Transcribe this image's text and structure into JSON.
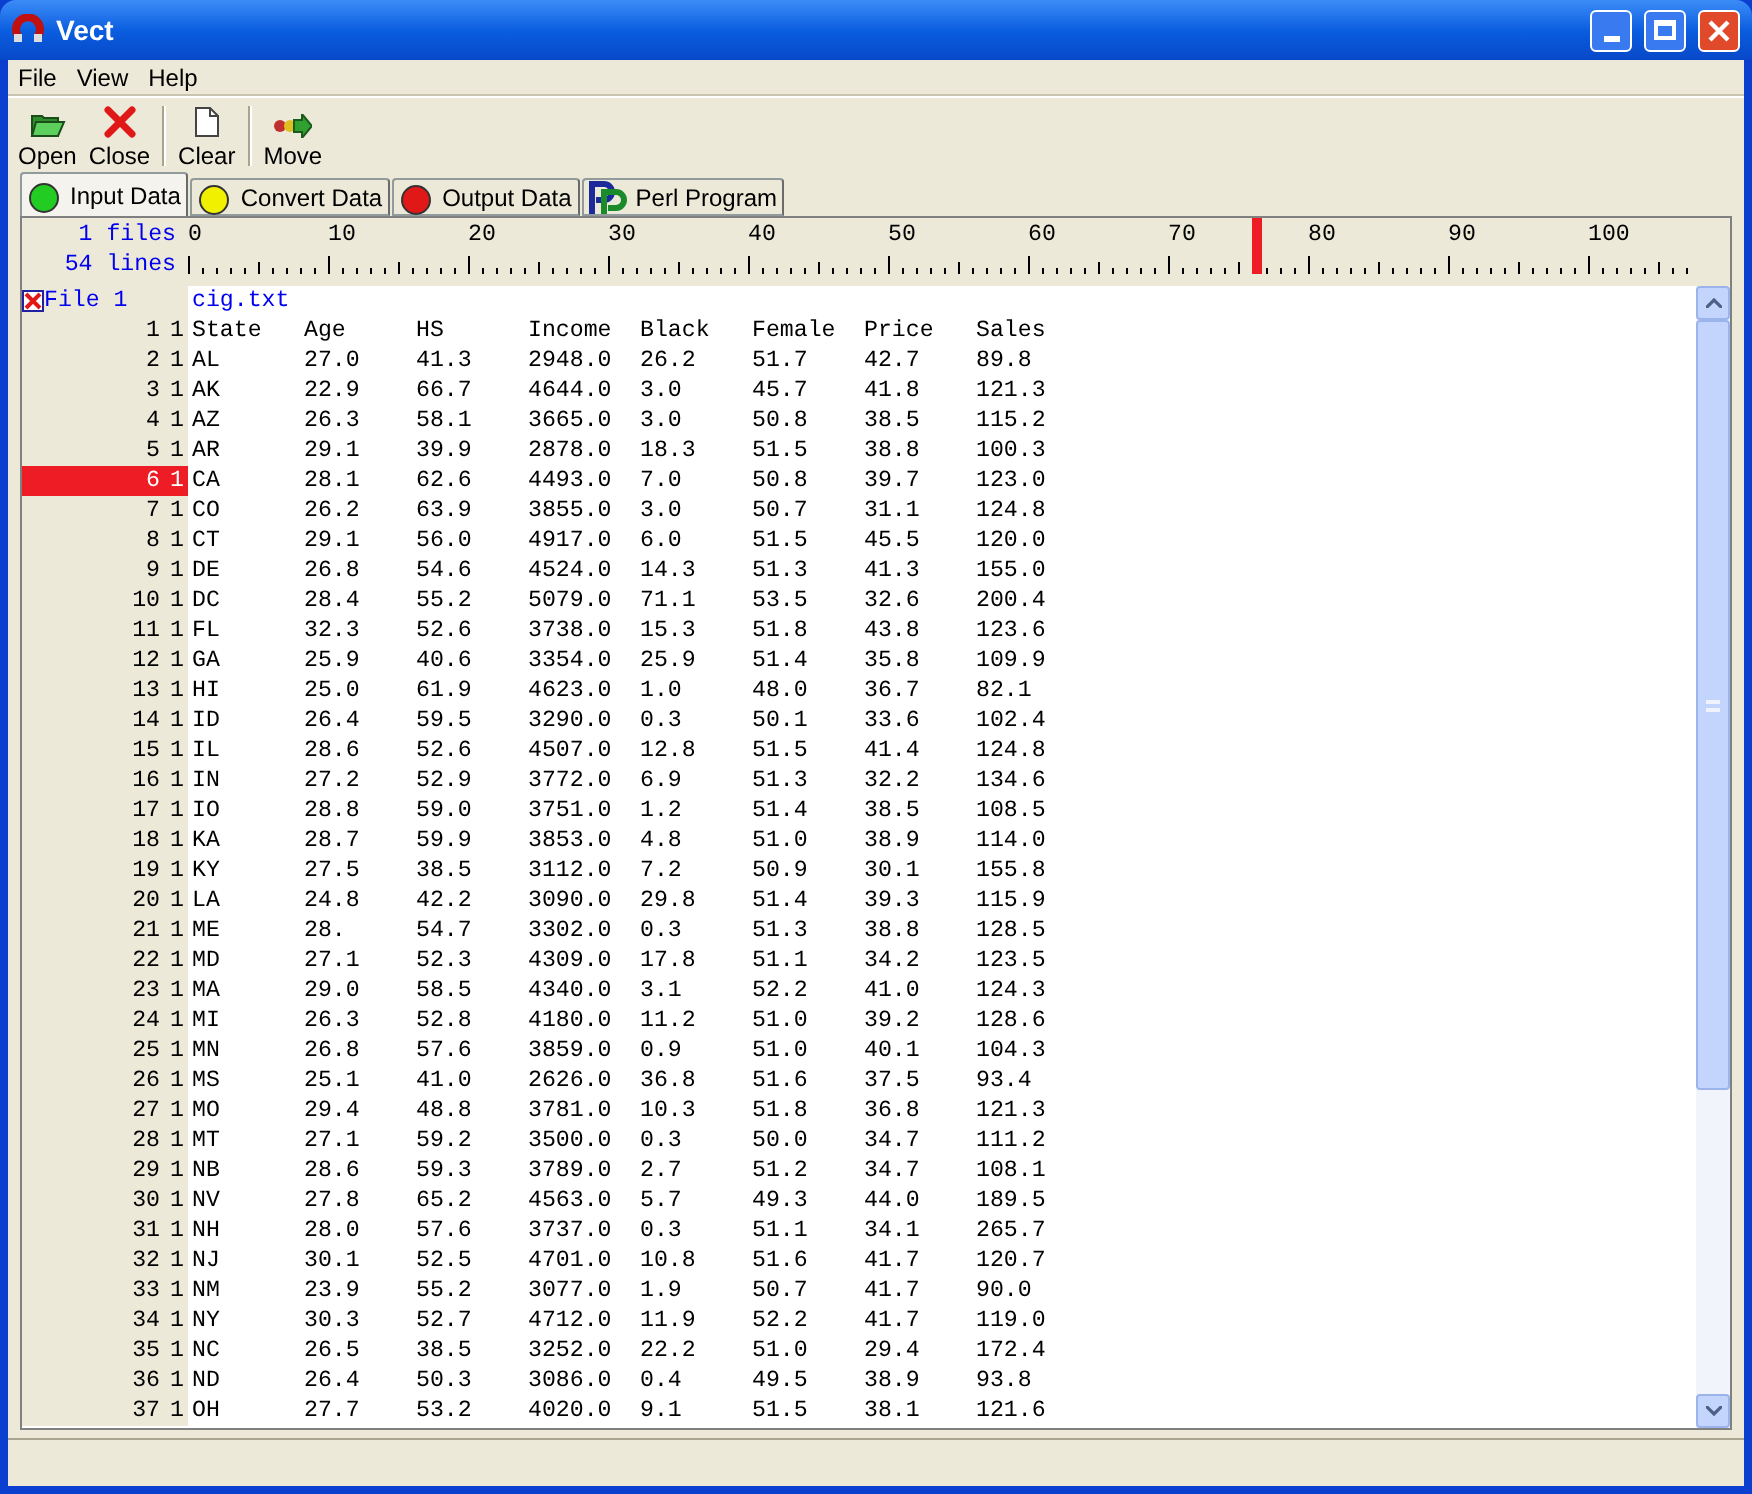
{
  "window": {
    "title": "Vect"
  },
  "menu": [
    "File",
    "View",
    "Help"
  ],
  "toolbar": [
    {
      "label": "Open",
      "kind": "open"
    },
    {
      "label": "Close",
      "kind": "close"
    },
    {
      "label": "Clear",
      "kind": "clear"
    },
    {
      "label": "Move",
      "kind": "move"
    }
  ],
  "tabs": [
    {
      "label": "Input Data",
      "kind": "light",
      "color": "#22cc22",
      "selected": true
    },
    {
      "label": "Convert Data",
      "kind": "light",
      "color": "#f0f000",
      "selected": false
    },
    {
      "label": "Output Data",
      "kind": "light",
      "color": "#e01818",
      "selected": false
    },
    {
      "label": "Perl Program",
      "kind": "perl",
      "selected": false
    }
  ],
  "info": {
    "files": "1 files",
    "lines": "54 lines"
  },
  "ruler": {
    "labels": [
      "0",
      "10",
      "20",
      "30",
      "40",
      "50",
      "60",
      "70",
      "80",
      "90",
      "100"
    ],
    "marker": {
      "level": 0.705
    }
  },
  "file": {
    "label": "File 1",
    "name": "cig.txt"
  },
  "rows": [
    {
      "n": "1",
      "f": "1",
      "selected": false,
      "cells": [
        "State",
        "Age",
        "HS",
        "Income",
        "Black",
        "Female",
        "Price",
        "Sales"
      ]
    },
    {
      "n": "2",
      "f": "1",
      "selected": false,
      "cells": [
        "AL",
        "27.0",
        "41.3",
        "2948.0",
        "26.2",
        "51.7",
        "42.7",
        "89.8"
      ]
    },
    {
      "n": "3",
      "f": "1",
      "selected": false,
      "cells": [
        "AK",
        "22.9",
        "66.7",
        "4644.0",
        "3.0",
        "45.7",
        "41.8",
        "121.3"
      ]
    },
    {
      "n": "4",
      "f": "1",
      "selected": false,
      "cells": [
        "AZ",
        "26.3",
        "58.1",
        "3665.0",
        "3.0",
        "50.8",
        "38.5",
        "115.2"
      ]
    },
    {
      "n": "5",
      "f": "1",
      "selected": false,
      "cells": [
        "AR",
        "29.1",
        "39.9",
        "2878.0",
        "18.3",
        "51.5",
        "38.8",
        "100.3"
      ]
    },
    {
      "n": "6",
      "f": "1",
      "selected": true,
      "cells": [
        "CA",
        "28.1",
        "62.6",
        "4493.0",
        "7.0",
        "50.8",
        "39.7",
        "123.0"
      ]
    },
    {
      "n": "7",
      "f": "1",
      "selected": false,
      "cells": [
        "CO",
        "26.2",
        "63.9",
        "3855.0",
        "3.0",
        "50.7",
        "31.1",
        "124.8"
      ]
    },
    {
      "n": "8",
      "f": "1",
      "selected": false,
      "cells": [
        "CT",
        "29.1",
        "56.0",
        "4917.0",
        "6.0",
        "51.5",
        "45.5",
        "120.0"
      ]
    },
    {
      "n": "9",
      "f": "1",
      "selected": false,
      "cells": [
        "DE",
        "26.8",
        "54.6",
        "4524.0",
        "14.3",
        "51.3",
        "41.3",
        "155.0"
      ]
    },
    {
      "n": "10",
      "f": "1",
      "selected": false,
      "cells": [
        "DC",
        "28.4",
        "55.2",
        "5079.0",
        "71.1",
        "53.5",
        "32.6",
        "200.4"
      ]
    },
    {
      "n": "11",
      "f": "1",
      "selected": false,
      "cells": [
        "FL",
        "32.3",
        "52.6",
        "3738.0",
        "15.3",
        "51.8",
        "43.8",
        "123.6"
      ]
    },
    {
      "n": "12",
      "f": "1",
      "selected": false,
      "cells": [
        "GA",
        "25.9",
        "40.6",
        "3354.0",
        "25.9",
        "51.4",
        "35.8",
        "109.9"
      ]
    },
    {
      "n": "13",
      "f": "1",
      "selected": false,
      "cells": [
        "HI",
        "25.0",
        "61.9",
        "4623.0",
        "1.0",
        "48.0",
        "36.7",
        "82.1"
      ]
    },
    {
      "n": "14",
      "f": "1",
      "selected": false,
      "cells": [
        "ID",
        "26.4",
        "59.5",
        "3290.0",
        "0.3",
        "50.1",
        "33.6",
        "102.4"
      ]
    },
    {
      "n": "15",
      "f": "1",
      "selected": false,
      "cells": [
        "IL",
        "28.6",
        "52.6",
        "4507.0",
        "12.8",
        "51.5",
        "41.4",
        "124.8"
      ]
    },
    {
      "n": "16",
      "f": "1",
      "selected": false,
      "cells": [
        "IN",
        "27.2",
        "52.9",
        "3772.0",
        "6.9",
        "51.3",
        "32.2",
        "134.6"
      ]
    },
    {
      "n": "17",
      "f": "1",
      "selected": false,
      "cells": [
        "IO",
        "28.8",
        "59.0",
        "3751.0",
        "1.2",
        "51.4",
        "38.5",
        "108.5"
      ]
    },
    {
      "n": "18",
      "f": "1",
      "selected": false,
      "cells": [
        "KA",
        "28.7",
        "59.9",
        "3853.0",
        "4.8",
        "51.0",
        "38.9",
        "114.0"
      ]
    },
    {
      "n": "19",
      "f": "1",
      "selected": false,
      "cells": [
        "KY",
        "27.5",
        "38.5",
        "3112.0",
        "7.2",
        "50.9",
        "30.1",
        "155.8"
      ]
    },
    {
      "n": "20",
      "f": "1",
      "selected": false,
      "cells": [
        "LA",
        "24.8",
        "42.2",
        "3090.0",
        "29.8",
        "51.4",
        "39.3",
        "115.9"
      ]
    },
    {
      "n": "21",
      "f": "1",
      "selected": false,
      "cells": [
        "ME",
        "28.",
        "54.7",
        "3302.0",
        "0.3",
        "51.3",
        "38.8",
        "128.5"
      ]
    },
    {
      "n": "22",
      "f": "1",
      "selected": false,
      "cells": [
        "MD",
        "27.1",
        "52.3",
        "4309.0",
        "17.8",
        "51.1",
        "34.2",
        "123.5"
      ]
    },
    {
      "n": "23",
      "f": "1",
      "selected": false,
      "cells": [
        "MA",
        "29.0",
        "58.5",
        "4340.0",
        "3.1",
        "52.2",
        "41.0",
        "124.3"
      ]
    },
    {
      "n": "24",
      "f": "1",
      "selected": false,
      "cells": [
        "MI",
        "26.3",
        "52.8",
        "4180.0",
        "11.2",
        "51.0",
        "39.2",
        "128.6"
      ]
    },
    {
      "n": "25",
      "f": "1",
      "selected": false,
      "cells": [
        "MN",
        "26.8",
        "57.6",
        "3859.0",
        "0.9",
        "51.0",
        "40.1",
        "104.3"
      ]
    },
    {
      "n": "26",
      "f": "1",
      "selected": false,
      "cells": [
        "MS",
        "25.1",
        "41.0",
        "2626.0",
        "36.8",
        "51.6",
        "37.5",
        "93.4"
      ]
    },
    {
      "n": "27",
      "f": "1",
      "selected": false,
      "cells": [
        "MO",
        "29.4",
        "48.8",
        "3781.0",
        "10.3",
        "51.8",
        "36.8",
        "121.3"
      ]
    },
    {
      "n": "28",
      "f": "1",
      "selected": false,
      "cells": [
        "MT",
        "27.1",
        "59.2",
        "3500.0",
        "0.3",
        "50.0",
        "34.7",
        "111.2"
      ]
    },
    {
      "n": "29",
      "f": "1",
      "selected": false,
      "cells": [
        "NB",
        "28.6",
        "59.3",
        "3789.0",
        "2.7",
        "51.2",
        "34.7",
        "108.1"
      ]
    },
    {
      "n": "30",
      "f": "1",
      "selected": false,
      "cells": [
        "NV",
        "27.8",
        "65.2",
        "4563.0",
        "5.7",
        "49.3",
        "44.0",
        "189.5"
      ]
    },
    {
      "n": "31",
      "f": "1",
      "selected": false,
      "cells": [
        "NH",
        "28.0",
        "57.6",
        "3737.0",
        "0.3",
        "51.1",
        "34.1",
        "265.7"
      ]
    },
    {
      "n": "32",
      "f": "1",
      "selected": false,
      "cells": [
        "NJ",
        "30.1",
        "52.5",
        "4701.0",
        "10.8",
        "51.6",
        "41.7",
        "120.7"
      ]
    },
    {
      "n": "33",
      "f": "1",
      "selected": false,
      "cells": [
        "NM",
        "23.9",
        "55.2",
        "3077.0",
        "1.9",
        "50.7",
        "41.7",
        "90.0"
      ]
    },
    {
      "n": "34",
      "f": "1",
      "selected": false,
      "cells": [
        "NY",
        "30.3",
        "52.7",
        "4712.0",
        "11.9",
        "52.2",
        "41.7",
        "119.0"
      ]
    },
    {
      "n": "35",
      "f": "1",
      "selected": false,
      "cells": [
        "NC",
        "26.5",
        "38.5",
        "3252.0",
        "22.2",
        "51.0",
        "29.4",
        "172.4"
      ]
    },
    {
      "n": "36",
      "f": "1",
      "selected": false,
      "cells": [
        "ND",
        "26.4",
        "50.3",
        "3086.0",
        "0.4",
        "49.5",
        "38.9",
        "93.8"
      ]
    },
    {
      "n": "37",
      "f": "1",
      "selected": false,
      "cells": [
        "OH",
        "27.7",
        "53.2",
        "4020.0",
        "9.1",
        "51.5",
        "38.1",
        "121.6"
      ]
    }
  ]
}
